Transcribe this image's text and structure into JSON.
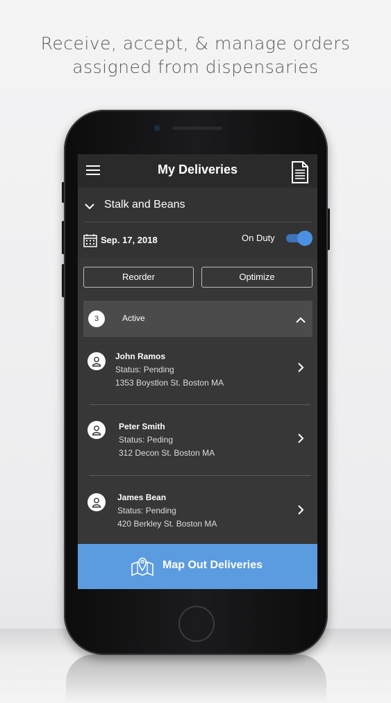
{
  "headline": {
    "line1": "Receive, accept, & manage orders",
    "line2": "assigned from dispensaries"
  },
  "app": {
    "title": "My Deliveries",
    "store": "Stalk and Beans",
    "date": "Sep. 17, 2018",
    "duty_label": "On Duty",
    "duty_on": true,
    "buttons": {
      "reorder": "Reorder",
      "optimize": "Optimize"
    },
    "active": {
      "count": "3",
      "label": "Active"
    },
    "deliveries": [
      {
        "name": "John Ramos",
        "status": "Status: Pending",
        "address": "1353 Boystlon St. Boston MA"
      },
      {
        "name": "Peter Smith",
        "status": "Status: Peding",
        "address": "312 Decon St. Boston MA"
      },
      {
        "name": "James Bean",
        "status": "Status: Pending",
        "address": "420 Berkley St. Boston MA"
      }
    ],
    "map_button": "Map Out Deliveries",
    "colors": {
      "accent": "#5b9be0",
      "toggle": "#4b90e2",
      "screen_bg": "#373737"
    },
    "icons": [
      "menu-icon",
      "document-icon",
      "chevron-down-icon",
      "calendar-icon",
      "person-icon",
      "chevron-right-icon",
      "chevron-up-icon",
      "map-pin-icon"
    ]
  }
}
